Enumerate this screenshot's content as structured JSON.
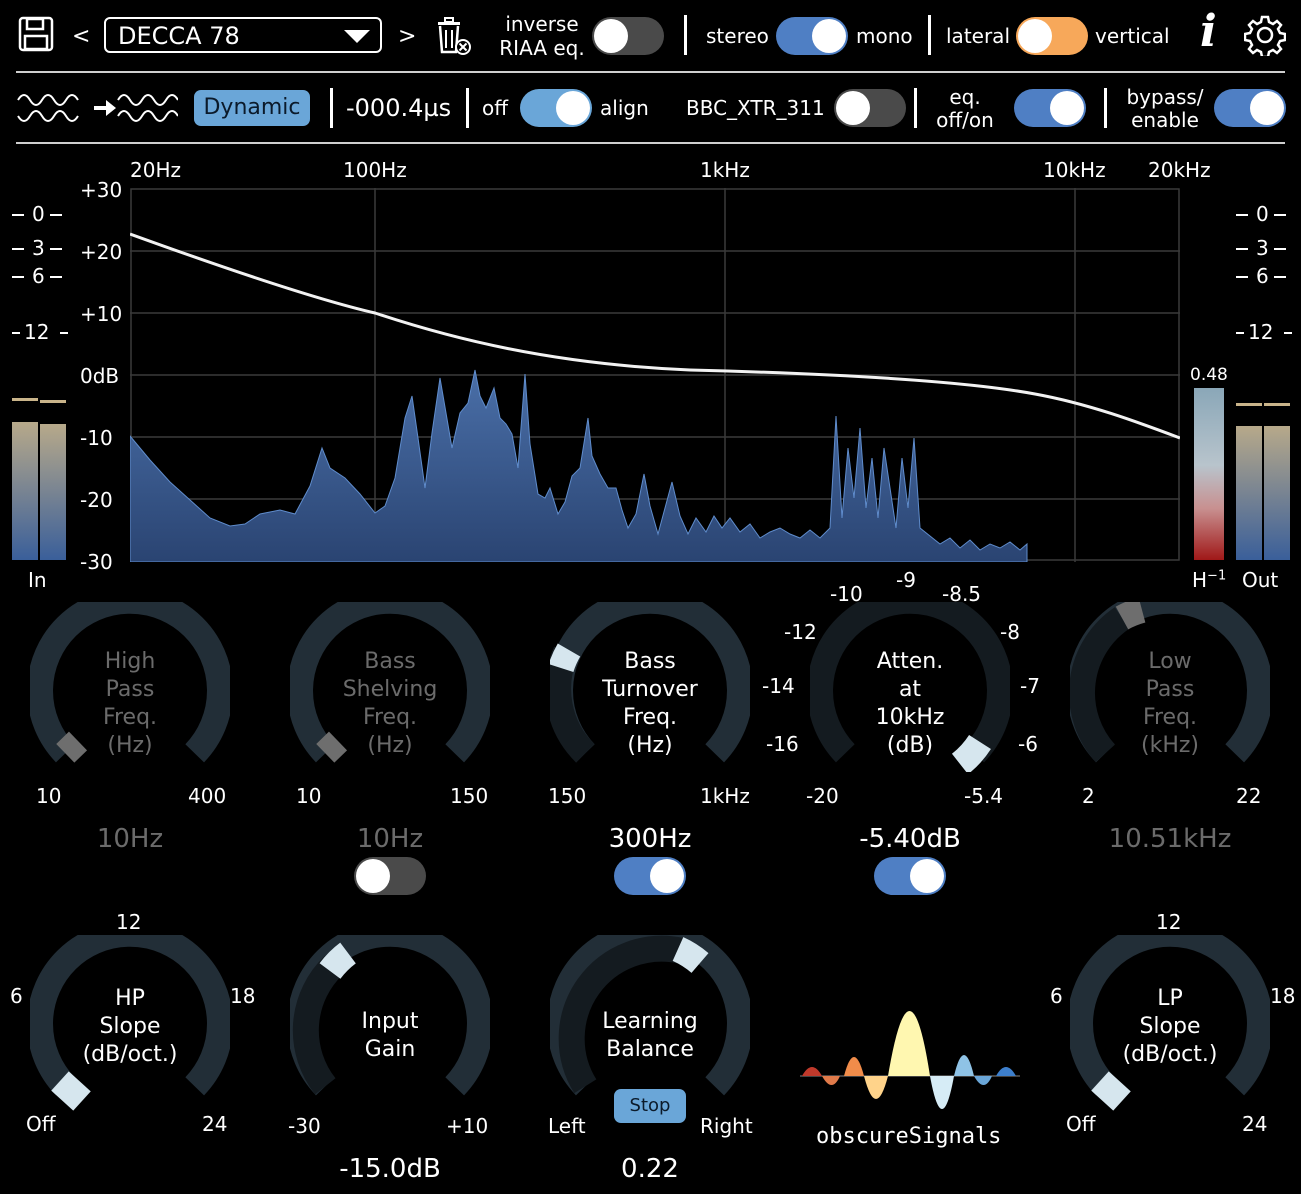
{
  "toolbar": {
    "save_icon": "floppy-disk-icon",
    "prev": "<",
    "next": ">",
    "preset": "DECCA 78",
    "delete_icon": "trash-icon",
    "inverse_riaa_line1": "inverse",
    "inverse_riaa_line2": "RIAA eq.",
    "stereo": "stereo",
    "mono": "mono",
    "lateral": "lateral",
    "vertical": "vertical",
    "info": "i",
    "settings_icon": "gear-icon"
  },
  "row2": {
    "waveform_icon": "waveform-align-icon",
    "dynamic": "Dynamic",
    "delay": "-000.4µs",
    "off": "off",
    "align": "align",
    "bbc": "BBC_XTR_311",
    "eq_line1": "eq.",
    "eq_line2": "off/on",
    "bypass_line1": "bypass/",
    "bypass_line2": "enable"
  },
  "spectrum": {
    "freq_labels": [
      "20Hz",
      "100Hz",
      "1kHz",
      "10kHz",
      "20kHz"
    ],
    "db_labels": [
      "+30",
      "+20",
      "+10",
      "0dB",
      "-10",
      "-20",
      "-30"
    ],
    "meter_labels": [
      "0",
      "3",
      "6",
      "12"
    ],
    "in": "In",
    "out": "Out",
    "h_label": "H",
    "h_sup": "−1",
    "h_value": "0.48"
  },
  "knobs": {
    "hp_freq": {
      "l1": "High",
      "l2": "Pass",
      "l3": "Freq.",
      "l4": "(Hz)",
      "min": "10",
      "max": "400",
      "value": "10Hz"
    },
    "bass_shelf": {
      "l1": "Bass",
      "l2": "Shelving",
      "l3": "Freq.",
      "l4": "(Hz)",
      "min": "10",
      "max": "150",
      "value": "10Hz"
    },
    "bass_turn": {
      "l1": "Bass",
      "l2": "Turnover",
      "l3": "Freq.",
      "l4": "(Hz)",
      "min": "150",
      "max": "1kHz",
      "value": "300Hz"
    },
    "atten": {
      "l1": "Atten.",
      "l2": "at",
      "l3": "10kHz",
      "l4": "(dB)",
      "min": "-20",
      "max": "-5.4",
      "value": "-5.40dB",
      "ticks": [
        "-9",
        "-10",
        "-8.5",
        "-12",
        "-8",
        "-14",
        "-7",
        "-16",
        "-6"
      ]
    },
    "lp_freq": {
      "l1": "Low",
      "l2": "Pass",
      "l3": "Freq.",
      "l4": "(kHz)",
      "min": "2",
      "max": "22",
      "value": "10.51kHz"
    },
    "hp_slope": {
      "l1": "HP",
      "l2": "Slope",
      "l3": "(dB/oct.)",
      "t_top": "12",
      "t_left": "6",
      "t_right": "18",
      "t_off": "Off",
      "t_24": "24"
    },
    "input_gain": {
      "l1": "Input",
      "l2": "Gain",
      "min": "-30",
      "max": "+10",
      "value": "-15.0dB"
    },
    "learning": {
      "l1": "Learning",
      "l2": "Balance",
      "stop": "Stop",
      "min": "Left",
      "max": "Right",
      "value": "0.22"
    },
    "lp_slope": {
      "l1": "LP",
      "l2": "Slope",
      "l3": "(dB/oct.)",
      "t_top": "12",
      "t_left": "6",
      "t_right": "18",
      "t_off": "Off",
      "t_24": "24"
    }
  },
  "brand": "obscureSignals",
  "colors": {
    "accent_blue": "#4f7fc4",
    "orange": "#f7a85a",
    "spectrum_fill": "#3a5a8c"
  }
}
